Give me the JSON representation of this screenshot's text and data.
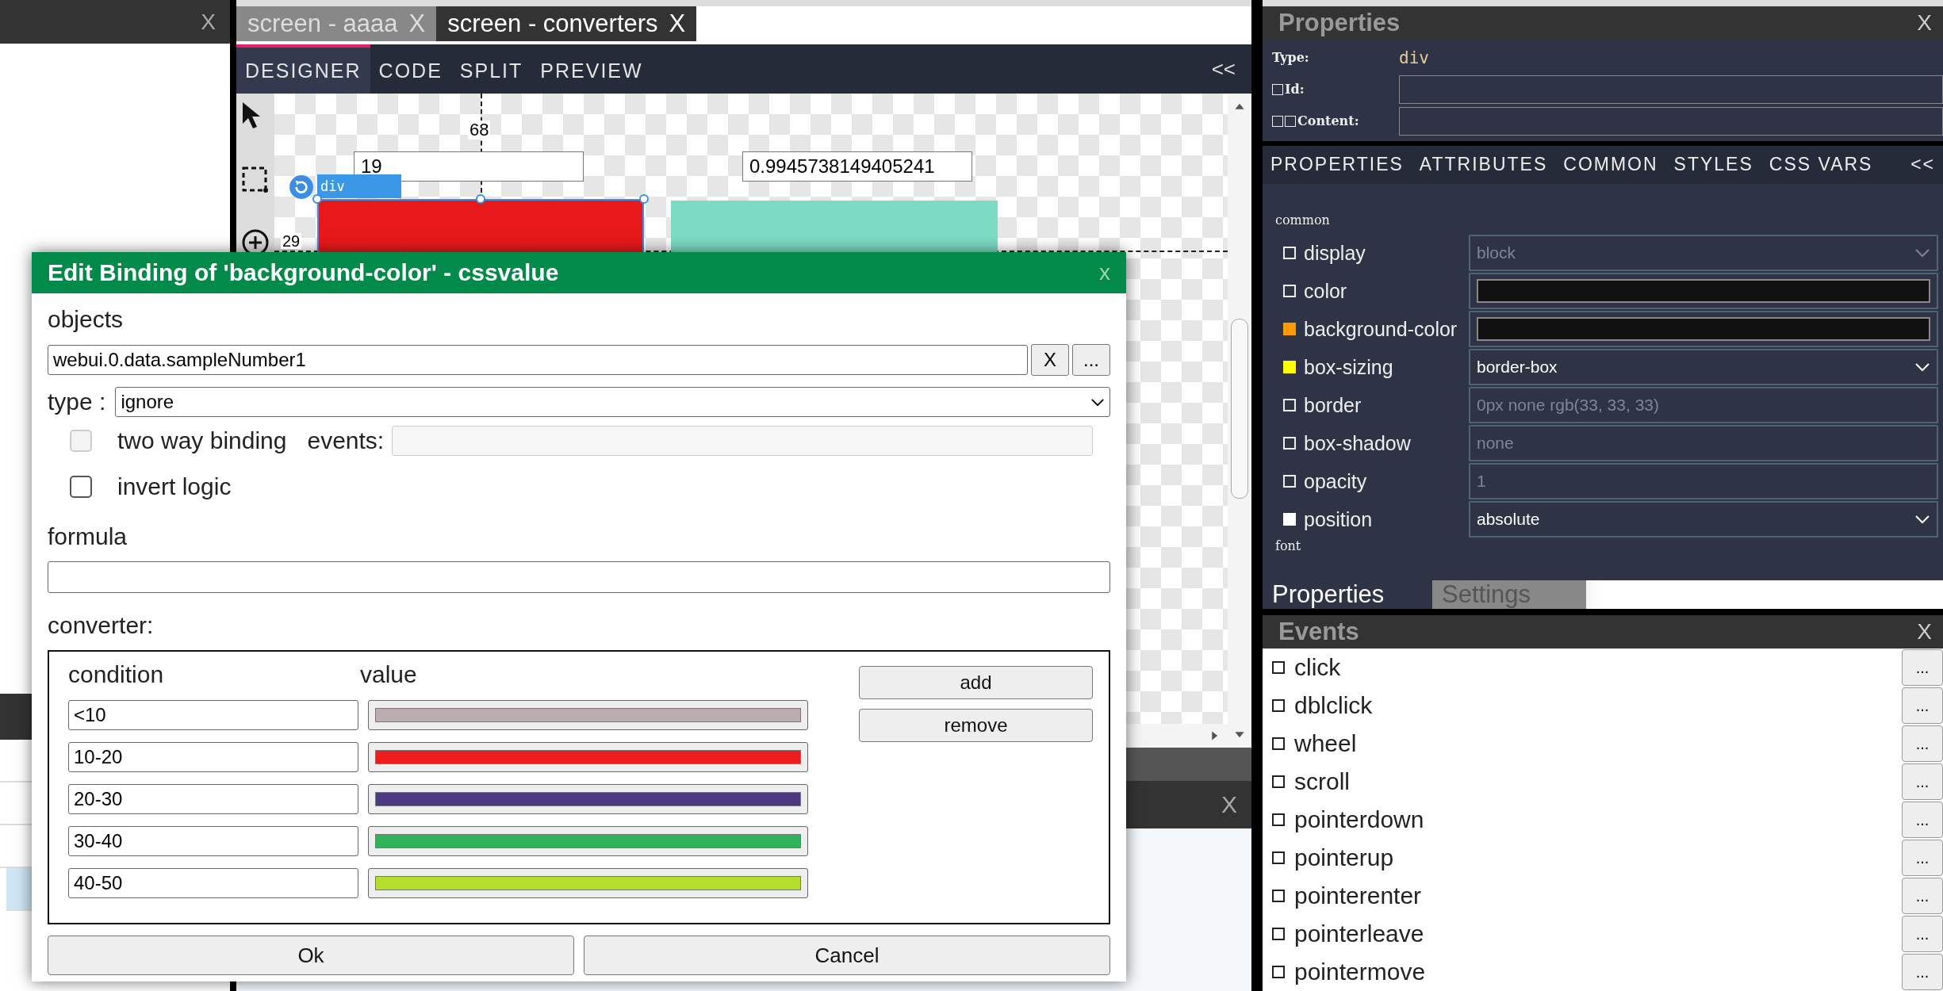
{
  "left_panel": {
    "close": "X"
  },
  "editor_tabs": [
    {
      "label": "screen - aaaa",
      "close": "X",
      "selected": false
    },
    {
      "label": "screen - converters",
      "close": "X",
      "selected": true
    }
  ],
  "designer_tabs": [
    {
      "label": "DESIGNER",
      "selected": true
    },
    {
      "label": "CODE",
      "selected": false
    },
    {
      "label": "SPLIT",
      "selected": false
    },
    {
      "label": "PREVIEW",
      "selected": false
    }
  ],
  "designer_collapse": "<<",
  "canvas": {
    "guide_label": "68",
    "offset_label": "29",
    "element_label": "div",
    "inputs": [
      {
        "value": "19"
      },
      {
        "value": "0.9945738149405241"
      }
    ]
  },
  "bottom_panel": {
    "close": "X"
  },
  "dialog": {
    "title": "Edit Binding of 'background-color' - cssvalue",
    "close": "x",
    "objects_label": "objects",
    "objects_value": "webui.0.data.sampleNumber1",
    "clear_button": "X",
    "browse_button": "...",
    "type_label": "type :",
    "type_value": "ignore",
    "two_way": {
      "label": "two way binding",
      "checked": false,
      "disabled": true
    },
    "events_label": "events:",
    "invert": {
      "label": "invert logic",
      "checked": false,
      "disabled": false
    },
    "formula_label": "formula",
    "converter_label": "converter:",
    "converter_headers": [
      "condition",
      "value"
    ],
    "converters": [
      {
        "condition": "<10",
        "color": "#bcaeae"
      },
      {
        "condition": "10-20",
        "color": "#ee1c1c"
      },
      {
        "condition": "20-30",
        "color": "#4b3a80"
      },
      {
        "condition": "30-40",
        "color": "#2fb35a"
      },
      {
        "condition": "40-50",
        "color": "#b5de2b"
      }
    ],
    "add_button": "add",
    "remove_button": "remove",
    "ok_button": "Ok",
    "cancel_button": "Cancel"
  },
  "properties": {
    "title": "Properties",
    "close": "X",
    "type_label": "Type:",
    "type_value": "div",
    "id_label": "Id:",
    "id_checked": false,
    "content_label": "Content:",
    "content_checks": [
      {
        "checked": false
      },
      {
        "checked": false
      }
    ],
    "tabs": [
      {
        "label": "PROPERTIES"
      },
      {
        "label": "ATTRIBUTES"
      },
      {
        "label": "COMMON"
      },
      {
        "label": "STYLES"
      },
      {
        "label": "CSS VARS"
      }
    ],
    "collapse": "<<",
    "section": "common",
    "rows": [
      {
        "name": "display",
        "set": false,
        "kind": "select",
        "value": "block"
      },
      {
        "name": "color",
        "set": false,
        "kind": "color"
      },
      {
        "name": "background-color",
        "set": true,
        "color": "#ff9900",
        "kind": "color"
      },
      {
        "name": "box-sizing",
        "set": true,
        "color": "#ffff00",
        "kind": "select",
        "value": "border-box"
      },
      {
        "name": "border",
        "set": false,
        "kind": "text",
        "placeholder": "0px none rgb(33, 33, 33)"
      },
      {
        "name": "box-shadow",
        "set": false,
        "kind": "text",
        "placeholder": "none"
      },
      {
        "name": "opacity",
        "set": false,
        "kind": "text",
        "placeholder": "1"
      },
      {
        "name": "position",
        "set": true,
        "color": "#ffffff",
        "kind": "select",
        "value": "absolute"
      }
    ],
    "next_section": "font",
    "bottom_tabs": [
      {
        "label": "Properties",
        "selected": true
      },
      {
        "label": "Settings",
        "selected": false
      }
    ]
  },
  "events": {
    "title": "Events",
    "close": "X",
    "button": "...",
    "items": [
      {
        "name": "click",
        "checked": false
      },
      {
        "name": "dblclick",
        "checked": false
      },
      {
        "name": "wheel",
        "checked": false
      },
      {
        "name": "scroll",
        "checked": false
      },
      {
        "name": "pointerdown",
        "checked": false
      },
      {
        "name": "pointerup",
        "checked": false
      },
      {
        "name": "pointerenter",
        "checked": false
      },
      {
        "name": "pointerleave",
        "checked": false
      },
      {
        "name": "pointermove",
        "checked": false
      }
    ]
  }
}
